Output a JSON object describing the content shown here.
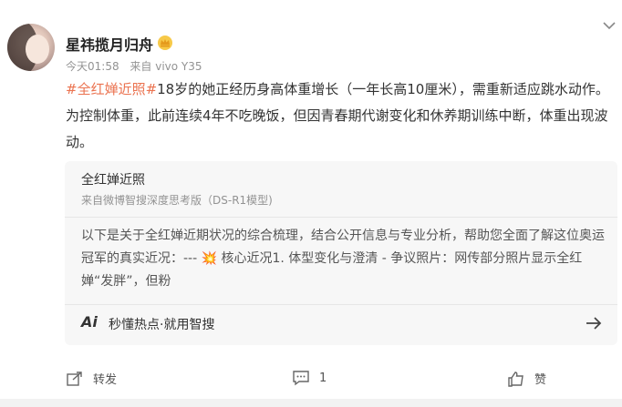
{
  "post": {
    "username": "星祎揽月归舟",
    "time": "今天01:58",
    "source": "来自 vivo Y35",
    "hashtag": "#全红婵近照#",
    "text": "18岁的她正经历身高体重增长（一年长高10厘米），需重新适应跳水动作。为控制体重，此前连续4年不吃晚饭，但因青春期代谢变化和休养期训练中断，体重出现波动。"
  },
  "quote": {
    "title": "全红婵近照",
    "source": "来自微博智搜深度思考版（DS-R1模型)",
    "body_before": "以下是关于全红婵近期状况的综合梳理，结合公开信息与专业分析，帮助您全面了解这位奥运冠军的真实近况：---",
    "burst": "💥",
    "body_after": " 核心近况1. 体型变化与澄清 - 争议照片：网传部分照片显示全红婵“发胖”，但粉",
    "ai_label": "Ai",
    "footer": "秒懂热点·就用智搜"
  },
  "actions": {
    "repost": "转发",
    "comment": "1",
    "like": "赞"
  },
  "colors": {
    "hashtag": "#eb7350",
    "meta": "#939393",
    "quote_bg": "#f7f7f7"
  },
  "icons": [
    "vip-crown-icon",
    "chevron-down-icon",
    "ai-icon",
    "arrow-right-icon",
    "repost-icon",
    "comment-icon",
    "like-icon"
  ]
}
